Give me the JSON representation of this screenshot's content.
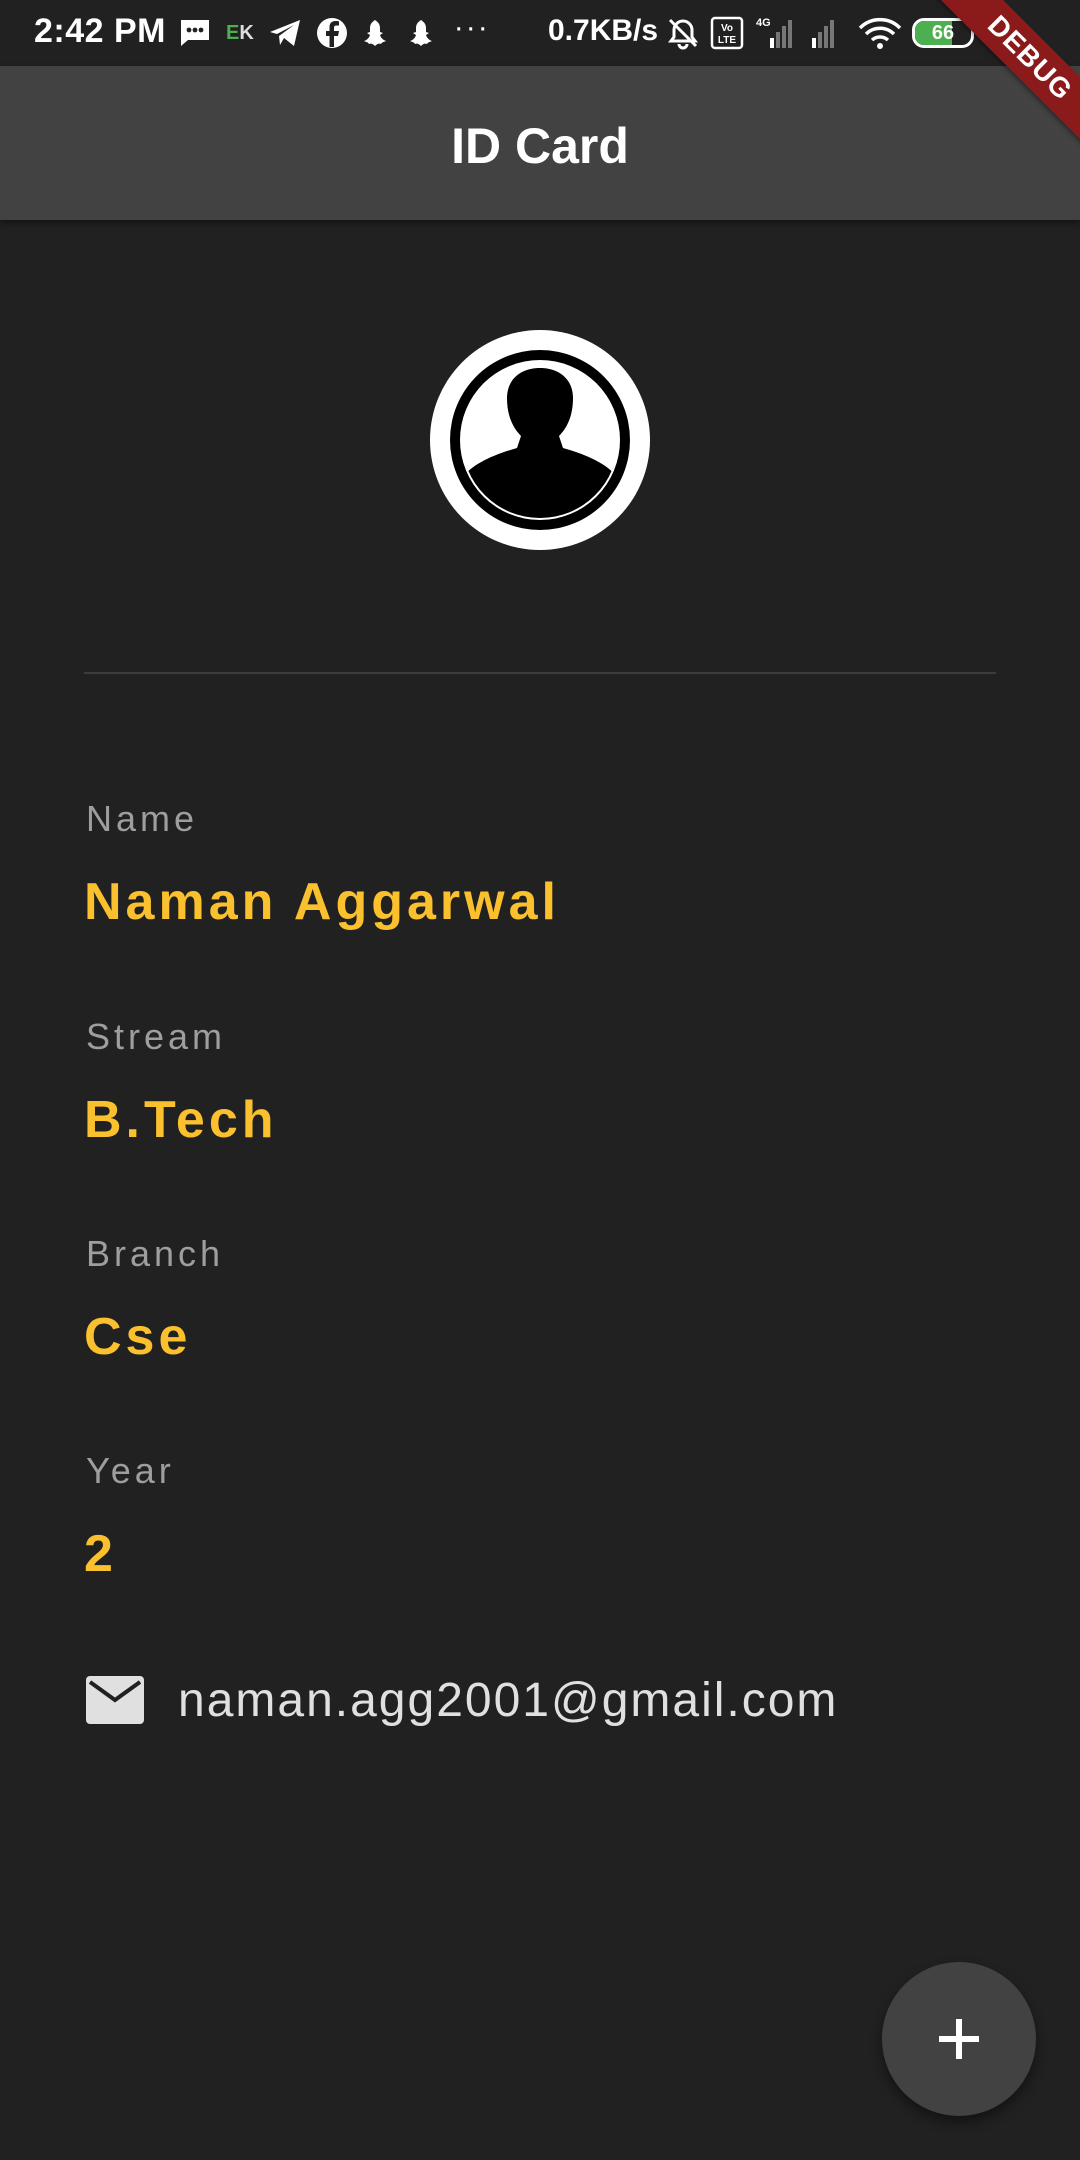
{
  "status_bar": {
    "time": "2:42 PM",
    "ek_label": "EK",
    "net_speed": "0.7KB/s",
    "network_type": "4G",
    "volte_label": "Vo LTE",
    "battery_level": "66",
    "icons": [
      "messages-icon",
      "telegram-icon",
      "facebook-icon",
      "snapchat-icon",
      "snapchat-icon",
      "more-dots-icon",
      "alarm-off-icon",
      "volte-icon",
      "signal-icon",
      "signal-icon",
      "wifi-icon",
      "battery-icon",
      "charging-icon"
    ]
  },
  "app_bar": {
    "title": "ID Card"
  },
  "debug_banner": "DEBUG",
  "profile": {
    "avatar_icon": "person-silhouette-icon",
    "fields": [
      {
        "label": "Name",
        "value": "Naman Aggarwal"
      },
      {
        "label": "Stream",
        "value": "B.Tech"
      },
      {
        "label": "Branch",
        "value": "Cse"
      },
      {
        "label": "Year",
        "value": "2"
      }
    ],
    "email_icon": "mail-icon",
    "email": "naman.agg2001@gmail.com"
  },
  "fab": {
    "icon": "plus-icon"
  },
  "colors": {
    "background": "#212121",
    "app_bar": "#424242",
    "accent": "#fbc02d",
    "label": "#9e9e9e"
  }
}
